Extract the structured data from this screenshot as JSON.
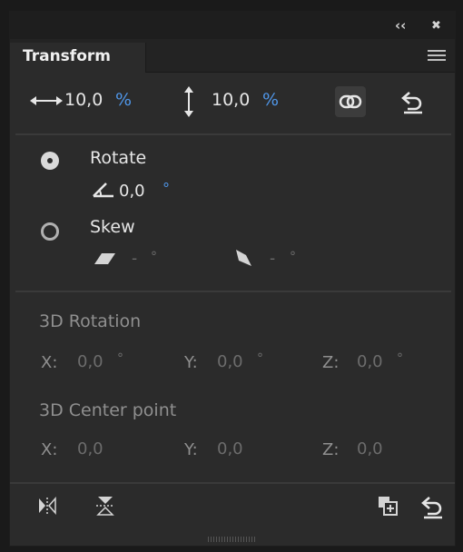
{
  "window": {
    "collapse_glyph": "‹‹",
    "close_glyph": "✖",
    "tab_label": "Transform"
  },
  "scale": {
    "width_value": "10,0",
    "height_value": "10,0",
    "unit": "%"
  },
  "rotate": {
    "label": "Rotate",
    "value": "0,0",
    "unit": "°",
    "selected": true
  },
  "skew": {
    "label": "Skew",
    "horizontal": "-",
    "vertical": "-",
    "unit": "°",
    "selected": false
  },
  "rotation3d": {
    "title": "3D Rotation",
    "x_label": "X:",
    "x_value": "0,0",
    "y_label": "Y:",
    "y_value": "0,0",
    "z_label": "Z:",
    "z_value": "0,0",
    "unit": "°"
  },
  "center3d": {
    "title": "3D Center point",
    "x_label": "X:",
    "x_value": "0,0",
    "y_label": "Y:",
    "y_value": "0,0",
    "z_label": "Z:",
    "z_value": "0,0"
  },
  "colors": {
    "accent": "#4f96e8",
    "panel_bg": "#2b2b2b",
    "text": "#e6e6e6",
    "disabled_text": "#6c6c6c"
  },
  "icons": [
    "collapse-icon",
    "close-icon",
    "panel-menu-icon",
    "width-arrows-icon",
    "height-arrows-icon",
    "link-icon",
    "reset-icon",
    "angle-icon",
    "skew-h-icon",
    "skew-v-icon",
    "flip-horizontal-icon",
    "flip-vertical-icon",
    "duplicate-transform-icon",
    "reset-transform-icon"
  ]
}
